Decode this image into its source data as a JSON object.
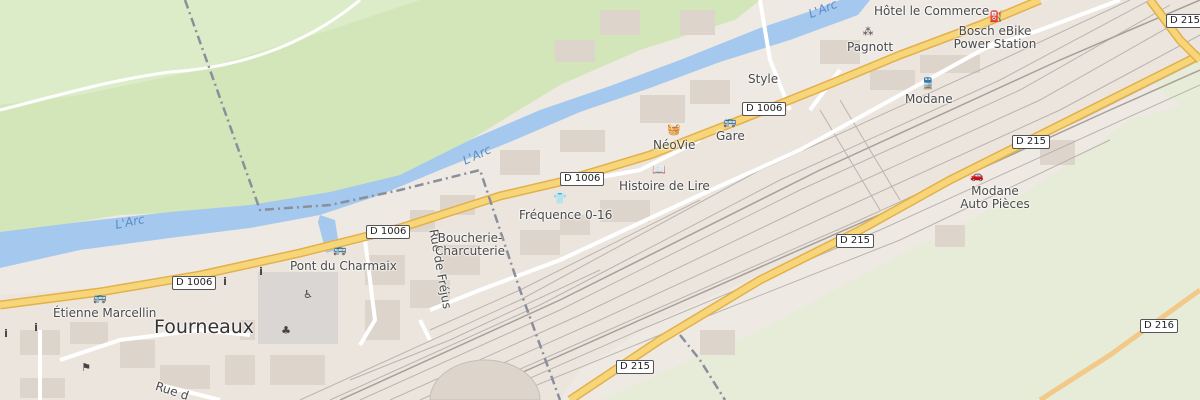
{
  "map": {
    "town_label": "Fourneaux",
    "colors": {
      "land": "#efe9e4",
      "forest": "#cfe3b6",
      "grass": "#e2ecd3",
      "water": "#a5c9ee",
      "major_road": "#f7d67a",
      "road_casing": "#e3b04b",
      "rail": "#b9b2ad",
      "boundary": "#8a8f9a",
      "building": "#ddd5cc"
    },
    "water_labels": [
      "L'Arc",
      "L'Arc",
      "L'Arc"
    ],
    "route_shields": [
      "D 1006",
      "D 1006",
      "D 1006",
      "D 1006",
      "D 215",
      "D 215",
      "D 215",
      "D 215",
      "D 216"
    ],
    "street_labels": [
      "Rue de Fréjus",
      "Rue d"
    ],
    "pois": [
      {
        "name": "Hôtel le Commerce",
        "icon": "none"
      },
      {
        "name": "Bosch eBike\nPower Station",
        "icon": "fuel-icon"
      },
      {
        "name": "Pagnott",
        "icon": "food-icon"
      },
      {
        "name": "Style",
        "icon": "none"
      },
      {
        "name": "Modane",
        "icon": "train-icon"
      },
      {
        "name": "Gare",
        "icon": "bus-icon"
      },
      {
        "name": "NéoVie",
        "icon": "basket-icon"
      },
      {
        "name": "Histoire de Lire",
        "icon": "book-icon"
      },
      {
        "name": "Fréquence 0-16",
        "icon": "shirt-icon"
      },
      {
        "name": "Boucherie-\nCharcuterie",
        "icon": "none"
      },
      {
        "name": "Pont du Charmaix",
        "icon": "bus-icon"
      },
      {
        "name": "Étienne Marcellin",
        "icon": "bus-icon"
      },
      {
        "name": "Modane\nAuto Pièces",
        "icon": "car-icon"
      }
    ],
    "info_markers": [
      "i",
      "i",
      "i",
      "i"
    ]
  }
}
